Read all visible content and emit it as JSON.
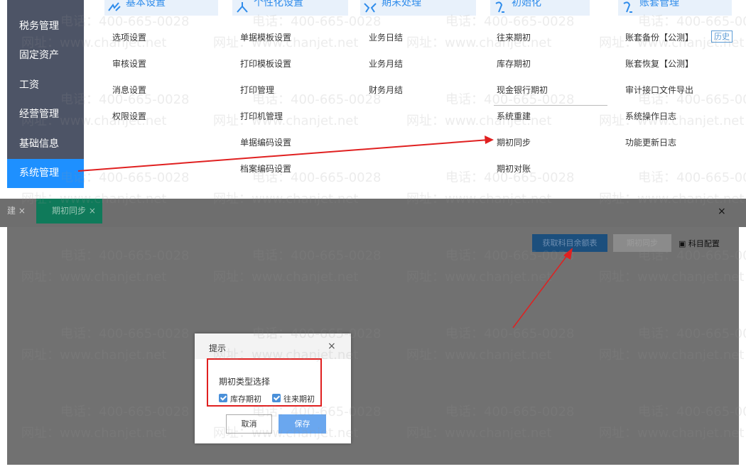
{
  "sidebar": {
    "items": [
      {
        "label": "税务管理"
      },
      {
        "label": "固定资产"
      },
      {
        "label": "工资"
      },
      {
        "label": "经营管理"
      },
      {
        "label": "基础信息"
      },
      {
        "label": "系统管理"
      }
    ]
  },
  "header_tabs": [
    {
      "label": "基本设置"
    },
    {
      "label": "个性化设置"
    },
    {
      "label": "期末处理"
    },
    {
      "label": "初始化"
    },
    {
      "label": "账套管理"
    }
  ],
  "menu": {
    "col1": [
      "选项设置",
      "审核设置",
      "消息设置",
      "权限设置"
    ],
    "col2": [
      "单据模板设置",
      "打印模板设置",
      "打印管理",
      "打印机管理",
      "单据编码设置",
      "档案编码设置"
    ],
    "col3": [
      "业务日结",
      "业务月结",
      "财务月结"
    ],
    "col4": [
      "往来期初",
      "库存期初",
      "现金银行期初",
      "系统重建",
      "期初同步",
      "期初对账"
    ],
    "col5": [
      "账套备份【公测】",
      "账套恢复【公测】",
      "审计接口文件导出",
      "系统操作日志",
      "功能更新日志"
    ],
    "history_button": "历史"
  },
  "tabs": {
    "tab1_label": "建 ×",
    "tab2_label": "期初同步 ×",
    "close_label": "×"
  },
  "toolbar": {
    "fetch_balance": "获取科目余额表",
    "sync_button": "期初同步",
    "subject_config": "科目配置"
  },
  "dialog": {
    "title": "提示",
    "close": "×",
    "label": "期初类型选择",
    "options": [
      {
        "label": "库存期初"
      },
      {
        "label": "往来期初"
      }
    ],
    "cancel": "取消",
    "save": "保存"
  },
  "watermark": {
    "phone": "电话：400-665-0028",
    "site": "网址：www.chanjet.net"
  },
  "colors": {
    "sidebar_bg": "#4d5466",
    "active": "#1e90ff",
    "tab_active": "#0f7a5a",
    "annotation": "#e02020"
  }
}
